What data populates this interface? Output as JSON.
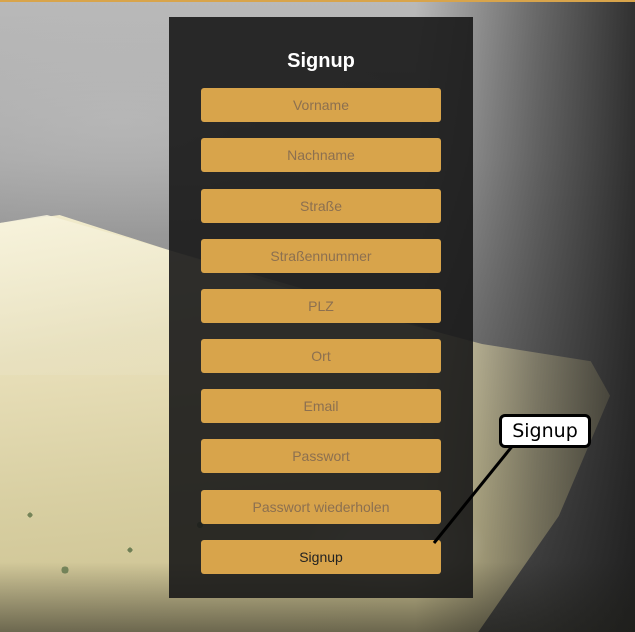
{
  "form": {
    "title": "Signup",
    "fields": [
      {
        "placeholder": "Vorname"
      },
      {
        "placeholder": "Nachname"
      },
      {
        "placeholder": "Straße"
      },
      {
        "placeholder": "Straßennummer"
      },
      {
        "placeholder": "PLZ"
      },
      {
        "placeholder": "Ort"
      },
      {
        "placeholder": "Email"
      },
      {
        "placeholder": "Passwort"
      },
      {
        "placeholder": "Passwort wiederholen"
      }
    ],
    "submit_label": "Signup"
  },
  "annotation": {
    "label": "Signup"
  },
  "colors": {
    "accent": "#d8a44b",
    "panel": "#181818",
    "title": "#ffffff"
  }
}
